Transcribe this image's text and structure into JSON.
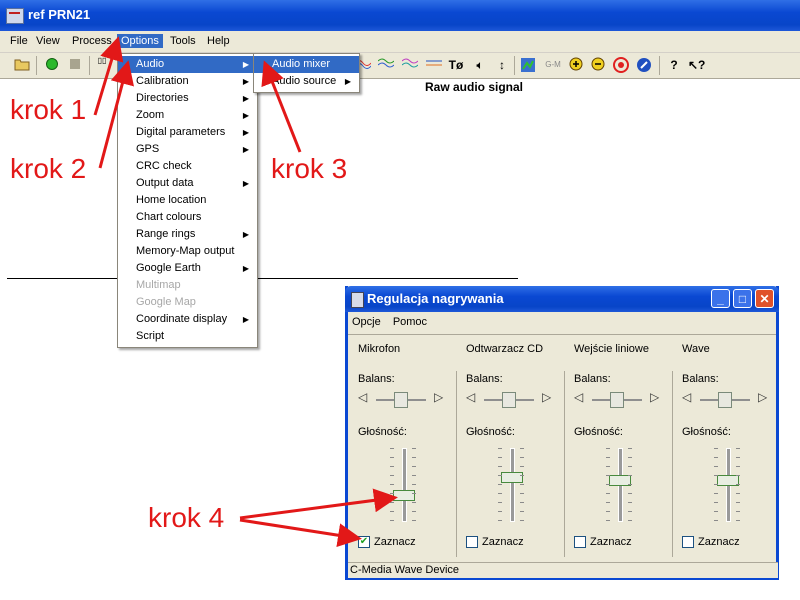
{
  "window": {
    "title": "ref PRN21"
  },
  "menubar": {
    "items": [
      "File",
      "View",
      "Process",
      "Options",
      "Tools",
      "Help"
    ],
    "selected": "Options"
  },
  "toolbar": {
    "icons": [
      "open-folder-icon",
      "green-circle-icon",
      "stop-square-icon",
      "scan-icon",
      "wave-red-icon",
      "wave-green-icon",
      "wave-blue-icon",
      "wave-multi-icon",
      "wave-yellow-icon",
      "theta-zero-icon",
      "speaker-icon",
      "vertical-arrows-icon",
      "map-icon",
      "gm-icon",
      "zoom-in-icon",
      "zoom-out-icon",
      "target-icon",
      "compass-icon",
      "help-icon",
      "whats-this-icon"
    ],
    "theta_label": "Tø",
    "gm_label": "G-M",
    "help_label": "?"
  },
  "chart": {
    "title": "Raw audio signal"
  },
  "options_menu": {
    "items": [
      {
        "label": "Audio",
        "submenu": true,
        "highlighted": true
      },
      {
        "label": "Calibration",
        "submenu": true
      },
      {
        "label": "Directories",
        "submenu": true
      },
      {
        "label": "Zoom",
        "submenu": true
      },
      {
        "label": "Digital parameters",
        "submenu": true
      },
      {
        "label": "GPS",
        "submenu": true
      },
      {
        "label": "CRC check",
        "submenu": false
      },
      {
        "label": "Output data",
        "submenu": true
      },
      {
        "label": "Home location",
        "submenu": false
      },
      {
        "label": "Chart colours",
        "submenu": false
      },
      {
        "label": "Range rings",
        "submenu": true
      },
      {
        "label": "Memory-Map output",
        "submenu": false
      },
      {
        "label": "Google Earth",
        "submenu": true
      },
      {
        "label": "Multimap",
        "submenu": false,
        "disabled": true
      },
      {
        "label": "Google Map",
        "submenu": false,
        "disabled": true
      },
      {
        "label": "Coordinate display",
        "submenu": true
      },
      {
        "label": "Script",
        "submenu": false
      }
    ]
  },
  "audio_submenu": {
    "items": [
      {
        "label": "Audio mixer",
        "submenu": false,
        "highlighted": true
      },
      {
        "label": "Audio source",
        "submenu": true
      }
    ]
  },
  "annotations": {
    "step1": "krok 1",
    "step2": "krok 2",
    "step3": "krok 3",
    "step4": "krok 4",
    "color": "#e21818"
  },
  "dialog": {
    "title": "Regulacja nagrywania",
    "menu": [
      "Opcje",
      "Pomoc"
    ],
    "balance_label": "Balans:",
    "volume_label": "Głośność:",
    "select_label": "Zaznacz",
    "channels": [
      {
        "name": "Mikrofon",
        "balance": 0.5,
        "volume": 0.35,
        "selected": true
      },
      {
        "name": "Odtwarzacz CD",
        "balance": 0.5,
        "volume": 0.6,
        "selected": false
      },
      {
        "name": "Wejście liniowe",
        "balance": 0.5,
        "volume": 0.55,
        "selected": false
      },
      {
        "name": "Wave",
        "balance": 0.5,
        "volume": 0.55,
        "selected": false
      }
    ],
    "status": "C-Media Wave Device"
  }
}
